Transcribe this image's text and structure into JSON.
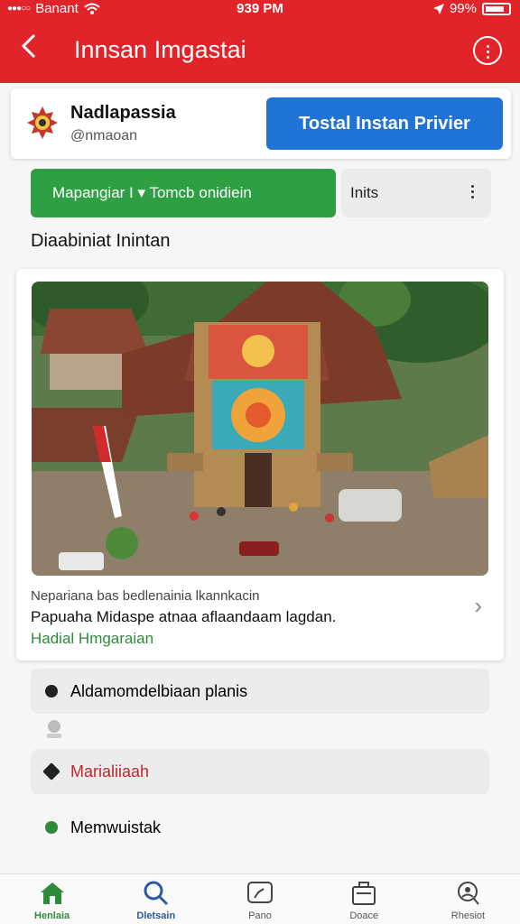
{
  "status": {
    "carrier": "Banant",
    "time": "939 PM",
    "battery": "99%"
  },
  "nav": {
    "title": "Innsan Imgastai"
  },
  "profile": {
    "name": "Nadlapassia",
    "handle": "@nmaoan",
    "install_label": "Tostal Instan Privier"
  },
  "actions": {
    "green_label": "Mapangiar I  ▾  Tomcb onidiein",
    "grey_label": "Inits"
  },
  "section_title": "Diaabiniat Inintan",
  "feed": {
    "caption1": "Nepariana bas bedlenainia lkannkacin",
    "caption2": "Papuaha Midaspe atnaa aflaandaam lagdan.",
    "caption3": "Hadial Hmgaraian"
  },
  "list": [
    {
      "label": "Aldamomdelbiaan planis",
      "color": "#222222"
    },
    {
      "label": "Marialiiaah",
      "color": "#c0272d"
    },
    {
      "label": "Memwuistak",
      "color": "#222222"
    }
  ],
  "tabs": [
    {
      "label": "Henlaia",
      "icon": "home-icon"
    },
    {
      "label": "Dletsain",
      "icon": "search-icon"
    },
    {
      "label": "Pano",
      "icon": "chat-icon"
    },
    {
      "label": "Doace",
      "icon": "briefcase-icon"
    },
    {
      "label": "Rhesiot",
      "icon": "profile-search-icon"
    }
  ],
  "colors": {
    "header": "#e0242a",
    "primary": "#1f73d6",
    "green": "#2ea043"
  }
}
